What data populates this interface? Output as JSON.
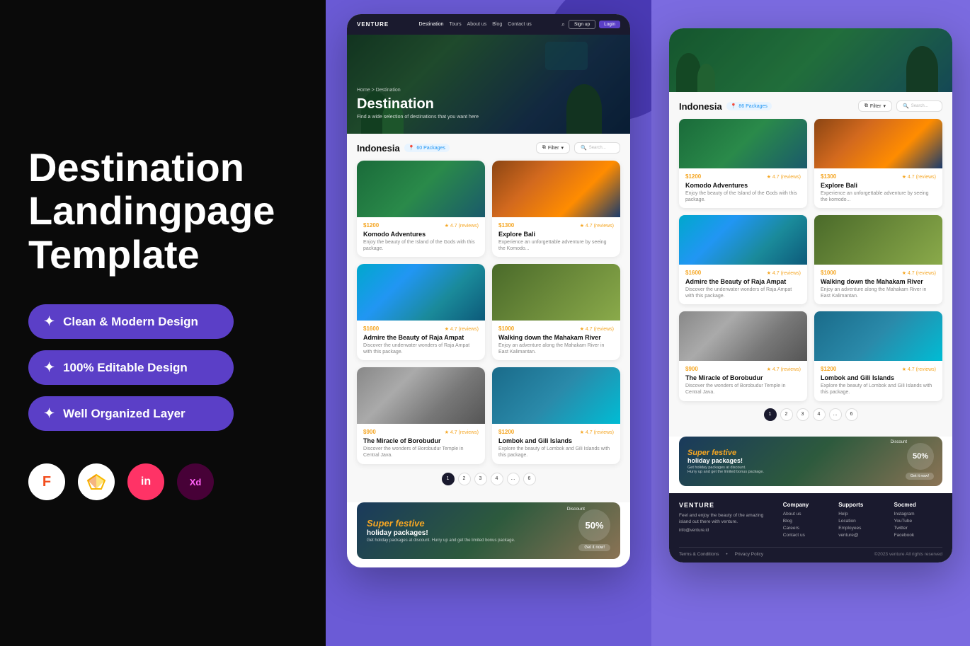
{
  "left": {
    "main_title": "Destination\nLandingpage\nTemplate",
    "features": [
      {
        "icon": "✦",
        "label": "Clean & Modern  Design"
      },
      {
        "icon": "✦",
        "label": "100% Editable Design"
      },
      {
        "icon": "✦",
        "label": "Well Organized Layer"
      }
    ],
    "tools": [
      "Figma",
      "Sketch",
      "InVision",
      "XD"
    ]
  },
  "center": {
    "nav": {
      "brand": "VENTURE",
      "links": [
        "Destination",
        "Tours",
        "About us",
        "Blog",
        "Contact us"
      ],
      "active_link": "Destination",
      "btn_signup": "Sign up",
      "btn_login": "Login"
    },
    "hero": {
      "breadcrumb": "Home > Destination",
      "title": "Destination",
      "subtitle": "Find a wide selection of destinations that you want here"
    },
    "destination_section": {
      "title": "Indonesia",
      "packages_count": "60 Packages",
      "filter_label": "Filter",
      "search_placeholder": "Search...",
      "cards": [
        {
          "price": "$1200",
          "rating": "4.7 (reviews)",
          "name": "Komodo Adventures",
          "desc": "Enjoy the beauty of the Island of the Gods with this package.",
          "img_class": "card-img-komodo"
        },
        {
          "price": "$1300",
          "rating": "4.7 (reviews)",
          "name": "Explore Bali",
          "desc": "Experience an unforgettable adventure by seeing the Komodo...",
          "img_class": "card-img-bali"
        },
        {
          "price": "$1600",
          "rating": "4.7 (reviews)",
          "name": "Admire the Beauty of Raja Ampat",
          "desc": "Discover the underwater wonders of Raja Ampat with this package.",
          "img_class": "card-img-raja"
        },
        {
          "price": "$1000",
          "rating": "4.7 (reviews)",
          "name": "Walking down the Mahakam River",
          "desc": "Enjoy an adventure along the Mahakam River in East Kalimantan.",
          "img_class": "card-img-mahakam"
        },
        {
          "price": "$900",
          "rating": "4.7 (reviews)",
          "name": "The Miracle of Borobudur",
          "desc": "Discover the wonders of Borobudur Temple in Central Java.",
          "img_class": "card-img-borobudur"
        },
        {
          "price": "$1200",
          "rating": "4.7 (reviews)",
          "name": "Lombok and Gili Islands",
          "desc": "Explore the beauty of Lombok and Gili Islands with this package.",
          "img_class": "card-img-lombok"
        }
      ],
      "pagination": [
        "1",
        "2",
        "3",
        "4",
        "...",
        "6"
      ]
    },
    "festive_banner": {
      "discount_label": "Discount",
      "title": "Super festive",
      "subtitle": "holiday packages!",
      "desc": "Get holiday packages at discount. Hurry up and get the limited bonus package.",
      "percent": "50%",
      "cta": "Get it now!"
    }
  },
  "right": {
    "destination_section": {
      "title": "Indonesia",
      "packages_count": "86 Packages",
      "filter_label": "Filter",
      "search_placeholder": "Search...",
      "cards": [
        {
          "price": "$1200",
          "rating": "4.7 (reviews)",
          "name": "Komodo Adventures",
          "desc": "Enjoy the beauty of the Island of the Gods with this package.",
          "img_class": "card-img-komodo"
        },
        {
          "price": "$1300",
          "rating": "4.7 (reviews)",
          "name": "Explore Bali",
          "desc": "Experience an unforgettable adventure by seeing the komodo...",
          "img_class": "card-img-bali"
        },
        {
          "price": "$1600",
          "rating": "4.7 (reviews)",
          "name": "Admire the Beauty of Raja Ampat",
          "desc": "Discover the underwater wonders of Raja Ampat with this package.",
          "img_class": "card-img-raja"
        },
        {
          "price": "$1000",
          "rating": "4.7 (reviews)",
          "name": "Walking down the Mahakam River",
          "desc": "Enjoy an adventure along the Mahakam River in East Kalimantan.",
          "img_class": "card-img-mahakam"
        },
        {
          "price": "$900",
          "rating": "4.7 (reviews)",
          "name": "The Miracle of Borobudur",
          "desc": "Discover the wonders of Borobudur Temple in Central Java.",
          "img_class": "card-img-borobudur"
        },
        {
          "price": "$1200",
          "rating": "4.7 (reviews)",
          "name": "Lombok and Gili Islands",
          "desc": "Explore the beauty of Lombok and Gili Islands with this package.",
          "img_class": "card-img-lombok"
        }
      ],
      "pagination": [
        "1",
        "2",
        "3",
        "4",
        "...",
        "6"
      ]
    },
    "festive_banner": {
      "discount_label": "Discount",
      "title": "Super festive",
      "subtitle": "holiday packages!",
      "percent": "50%",
      "cta": "Get it now!"
    },
    "footer": {
      "brand": "VENTURE",
      "desc": "Feel and enjoy the beauty of the amazing island out there with venture.",
      "columns": [
        {
          "title": "Company",
          "items": [
            "About us",
            "Blog",
            "Careers",
            "Contact us"
          ]
        },
        {
          "title": "Supports",
          "items": [
            "Help",
            "Location",
            "Employees",
            "venture@"
          ]
        },
        {
          "title": "Socmed",
          "items": [
            "Instagram",
            "YouTube",
            "Twitter",
            "Facebook"
          ]
        }
      ],
      "terms": "Terms & Conditions",
      "privacy": "Privacy Policy",
      "copyright": "©2023 venture All rights reserved"
    }
  }
}
